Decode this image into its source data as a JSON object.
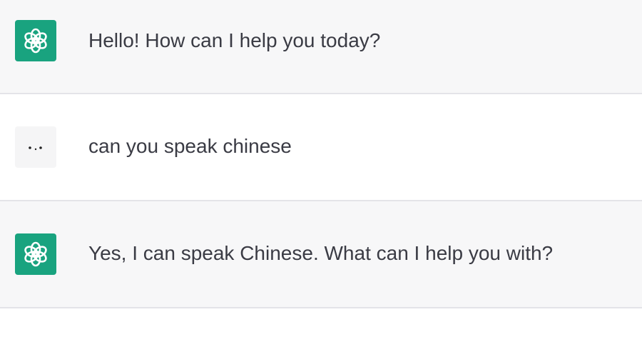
{
  "conversation": {
    "messages": [
      {
        "role": "assistant",
        "avatar_icon": "openai-logo-icon",
        "text": "Hello! How can I help you today?"
      },
      {
        "role": "user",
        "avatar_icon": "user-avatar-icon",
        "text": "can you speak chinese"
      },
      {
        "role": "assistant",
        "avatar_icon": "openai-logo-icon",
        "text": "Yes, I can speak Chinese. What can I help you with?"
      }
    ]
  },
  "colors": {
    "assistant_row_bg": "#f7f7f8",
    "user_row_bg": "#ffffff",
    "bot_avatar_bg": "#19a37f",
    "text": "#3a3b44",
    "divider": "#e4e4e8"
  }
}
